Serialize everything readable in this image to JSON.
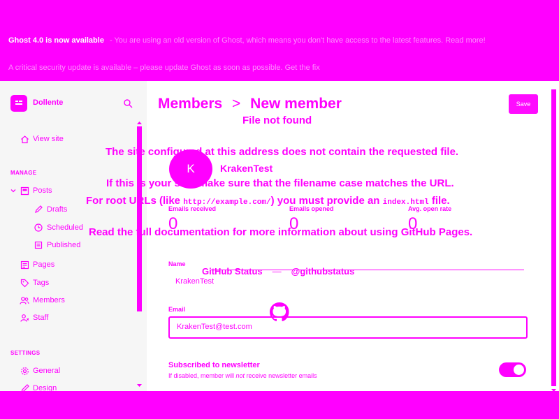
{
  "banner": {
    "line1_bold": "Ghost 4.0 is now available",
    "line1_rest": "- You are using an old version of Ghost, which means you don't have access to the latest features. Read more!",
    "line2": "A critical security update is available – please update Ghost as soon as possible. Get the fix"
  },
  "sidebar": {
    "site_name": "Dollente",
    "view_site": "View site",
    "manage_heading": "MANAGE",
    "settings_heading": "SETTINGS",
    "items": {
      "posts": "Posts",
      "drafts": "Drafts",
      "scheduled": "Scheduled",
      "published": "Published",
      "pages": "Pages",
      "tags": "Tags",
      "members": "Members",
      "staff": "Staff",
      "general": "General",
      "design": "Design"
    }
  },
  "header": {
    "breadcrumb_parent": "Members",
    "breadcrumb_separator": ">",
    "breadcrumb_current": "New member",
    "save_label": "Save"
  },
  "member": {
    "avatar_initial": "K",
    "name": "KrakenTest",
    "stats": {
      "emails_received_label": "Emails received",
      "emails_received_value": "0",
      "emails_opened_label": "Emails opened",
      "emails_opened_value": "0",
      "open_rate_label": "Avg. open rate",
      "open_rate_value": "0"
    }
  },
  "form": {
    "name_label": "Name",
    "name_value": "KrakenTest",
    "email_label": "Email",
    "email_value": "KrakenTest@test.com",
    "newsletter_label": "Subscribed to newsletter",
    "newsletter_help_pre": "If disabled, member will ",
    "newsletter_help_em": "not",
    "newsletter_help_post": " receive newsletter emails",
    "newsletter_enabled": true
  },
  "overlay": {
    "title": "File not found",
    "line1": "The site configured at this address does not contain the requested file.",
    "line2": "If this is your site, make sure that the filename case matches the URL.",
    "line3_pre": "For root URLs (like ",
    "line3_code1": "http://example.com/",
    "line3_mid": ") you must provide an ",
    "line3_code2": "index.html",
    "line3_post": " file.",
    "line4_pre": "Read the full documentation",
    "line4_mid": " for more information about using ",
    "line4_link": "GitHub Pages",
    "line4_post": ".",
    "status_link": "GitHub Status",
    "status_sep": "—",
    "twitter_link": "@githubstatus"
  },
  "colors": {
    "accent": "#ff00ff",
    "background": "#ffffff",
    "sidebar_background": "#f6f6f6"
  }
}
